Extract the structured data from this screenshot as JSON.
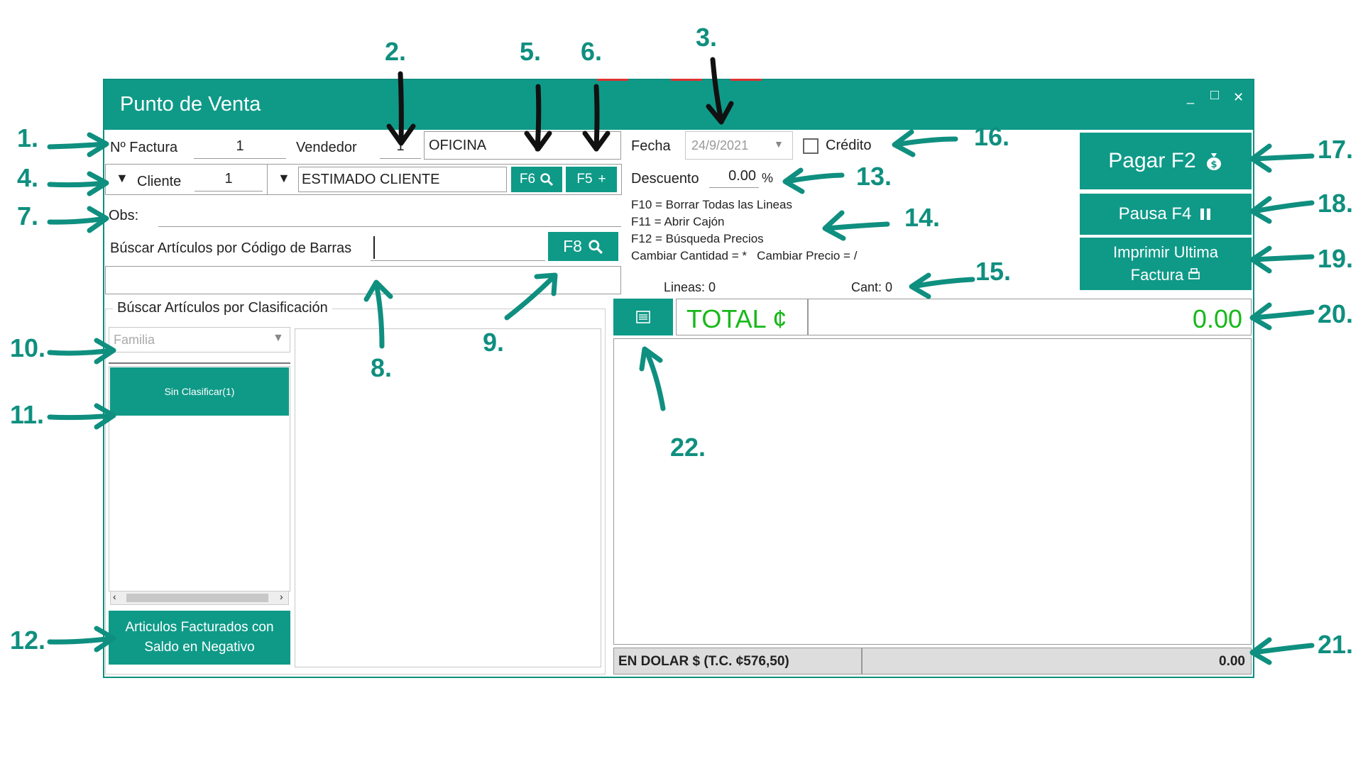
{
  "window": {
    "title": "Punto de Venta",
    "controls": {
      "minimize": "_",
      "maximize": "□",
      "close": "✕"
    }
  },
  "header": {
    "factura_label": "Nº Factura",
    "factura_value": "1",
    "vendedor_label": "Vendedor",
    "vendedor_value": "1",
    "vendedor_name": "OFICINA",
    "fecha_label": "Fecha",
    "fecha_value": "24/9/2021",
    "credito_label": "Crédito"
  },
  "cliente": {
    "label": "Cliente",
    "value": "1",
    "name": "ESTIMADO CLIENTE",
    "f6_label": "F6",
    "f5_label": "F5"
  },
  "obs": {
    "label": "Obs:"
  },
  "barcode": {
    "label": "Búscar Artículos por Código de Barras",
    "f8_label": "F8"
  },
  "descuento": {
    "label": "Descuento",
    "value": "0.00",
    "unit": "%"
  },
  "shortcuts": [
    "F10 = Borrar Todas las Lineas",
    "F11 = Abrir Cajón",
    "F12 = Búsqueda Precios",
    "Cambiar Cantidad = *   Cambiar Precio = /"
  ],
  "counts": {
    "lineas": "Lineas: 0",
    "cant": "Cant: 0"
  },
  "clasificacion": {
    "legend": "Búscar Artículos por Clasificación",
    "family_placeholder": "Familia",
    "item": "Sin Clasificar(1)",
    "negativo_line1": "Articulos Facturados con",
    "negativo_line2": "Saldo en Negativo"
  },
  "actions": {
    "pagar": "Pagar F2",
    "pausa": "Pausa F4",
    "imprimir_line1": "Imprimir Ultima",
    "imprimir_line2": "Factura"
  },
  "totals": {
    "total_label": "TOTAL ¢",
    "total_value": "0.00",
    "dolar_label": "EN DOLAR $ (T.C. ¢576,50)",
    "dolar_value": "0.00"
  },
  "annotations": [
    "1.",
    "2.",
    "3.",
    "4.",
    "5.",
    "6.",
    "7.",
    "8.",
    "9.",
    "10.",
    "11.",
    "12.",
    "13.",
    "14.",
    "15.",
    "16.",
    "17.",
    "18.",
    "19.",
    "20.",
    "21.",
    "22."
  ],
  "colors": {
    "teal": "#0f9a88",
    "total_green": "#18b81a",
    "annotation": "#0f8f7f"
  }
}
